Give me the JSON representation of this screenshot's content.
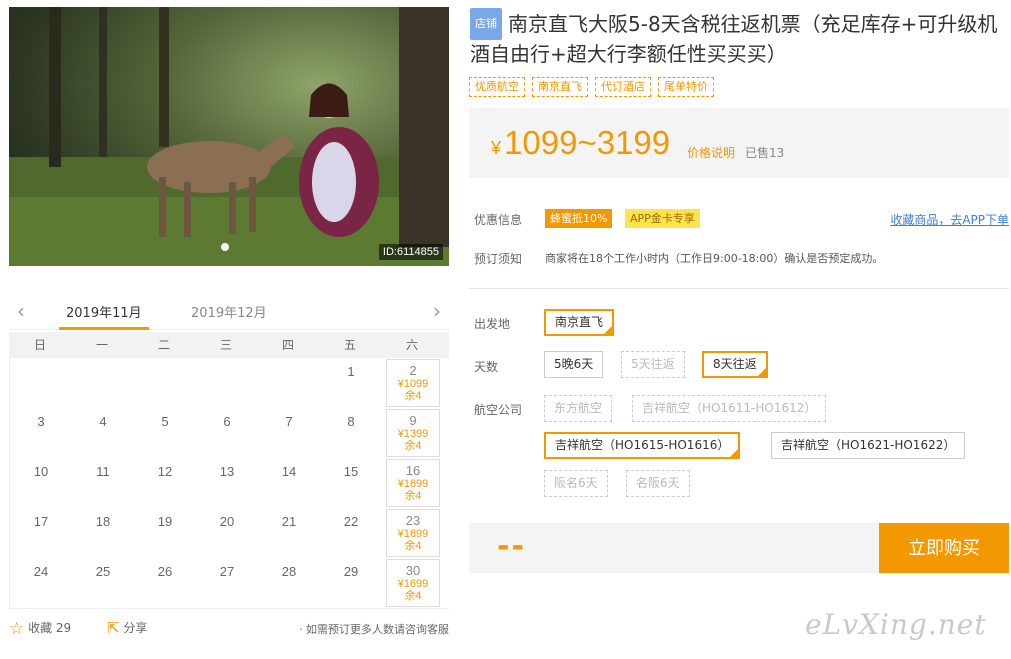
{
  "photo": {
    "id_label": "ID:6114855"
  },
  "product": {
    "store_tag": "店铺",
    "title": "南京直飞大阪5-8天含税往返机票（充足库存+可升级机酒自由行+超大行李额任性买买买）",
    "tags": [
      "优质航空",
      "南京直飞",
      "代订酒店",
      "尾单特价"
    ]
  },
  "price": {
    "yen": "¥",
    "range": "1099~3199",
    "note": "价格说明",
    "sold": "已售13"
  },
  "promo": {
    "label": "优惠信息",
    "badge1": "蜂蜜抵10%",
    "badge2": "APP金卡专享",
    "app_link": "收藏商品，去APP下单"
  },
  "booking": {
    "label": "预订须知",
    "text": "商家将在18个工作小时内（工作日9:00-18:00）确认是否预定成功。"
  },
  "options": {
    "departure_label": "出发地",
    "departure": "南京直飞",
    "days_label": "天数",
    "days": [
      "5晚6天",
      "5天往返",
      "8天往返"
    ],
    "airline_label": "航空公司",
    "airlines": [
      "东方航空",
      "吉祥航空（HO1611-HO1612）",
      "吉祥航空（HO1615-HO1616）",
      "吉祥航空（HO1621-HO1622）",
      "阪名6天",
      "名阪6天"
    ]
  },
  "buy": {
    "price": "--",
    "button": "立即购买"
  },
  "watermark": "eLvXing.net",
  "calendar": {
    "prev": "‹",
    "next": "›",
    "months": [
      "2019年11月",
      "2019年12月"
    ],
    "weekdays": [
      "日",
      "一",
      "二",
      "三",
      "四",
      "五",
      "六"
    ],
    "days": [
      {
        "d": ""
      },
      {
        "d": ""
      },
      {
        "d": ""
      },
      {
        "d": ""
      },
      {
        "d": ""
      },
      {
        "d": "1"
      },
      {
        "d": "2",
        "p": "¥1099",
        "r": "余4"
      },
      {
        "d": "3"
      },
      {
        "d": "4"
      },
      {
        "d": "5"
      },
      {
        "d": "6"
      },
      {
        "d": "7"
      },
      {
        "d": "8"
      },
      {
        "d": "9",
        "p": "¥1399",
        "r": "余4"
      },
      {
        "d": "10"
      },
      {
        "d": "11"
      },
      {
        "d": "12"
      },
      {
        "d": "13"
      },
      {
        "d": "14"
      },
      {
        "d": "15"
      },
      {
        "d": "16",
        "p": "¥1699",
        "r": "余4"
      },
      {
        "d": "17"
      },
      {
        "d": "18"
      },
      {
        "d": "19"
      },
      {
        "d": "20"
      },
      {
        "d": "21"
      },
      {
        "d": "22"
      },
      {
        "d": "23",
        "p": "¥1699",
        "r": "余4"
      },
      {
        "d": "24"
      },
      {
        "d": "25"
      },
      {
        "d": "26"
      },
      {
        "d": "27"
      },
      {
        "d": "28"
      },
      {
        "d": "29"
      },
      {
        "d": "30",
        "p": "¥1699",
        "r": "余4"
      }
    ],
    "favorite": "收藏 29",
    "share": "分享",
    "contact": "· 如需预订更多人数请咨询客服"
  },
  "icons": {
    "star": "star-icon",
    "share": "share-icon"
  },
  "colors": {
    "accent": "#f39800",
    "link": "#3c7fd8",
    "store_tag": "#7aa7e8"
  }
}
